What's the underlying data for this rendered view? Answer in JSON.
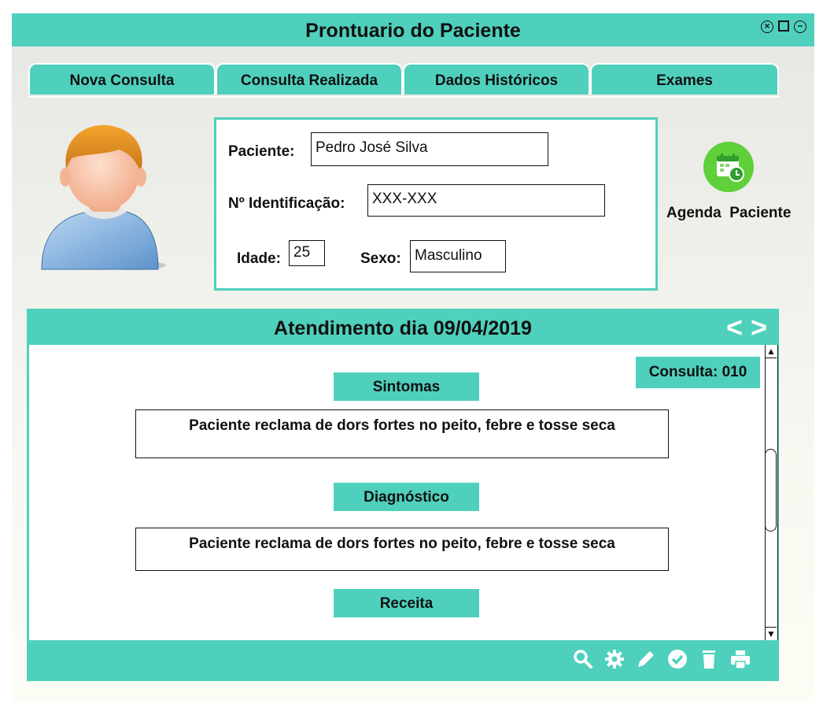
{
  "window": {
    "title": "Prontuario do Paciente"
  },
  "tabs": [
    {
      "label": "Nova Consulta"
    },
    {
      "label": "Consulta Realizada"
    },
    {
      "label": "Dados Históricos"
    },
    {
      "label": "Exames"
    }
  ],
  "patient": {
    "name_label": "Paciente:",
    "name_value": "Pedro José Silva",
    "id_label": "Nº Identificação:",
    "id_value": "XXX-XXX",
    "age_label": "Idade:",
    "age_value": "25",
    "sex_label": "Sexo:",
    "sex_value": "Masculino"
  },
  "agenda": {
    "label": "Agenda  Paciente",
    "icon": "calendar-clock-icon"
  },
  "atendimento": {
    "title": "Atendimento dia 09/04/2019",
    "consulta_badge": "Consulta: 010",
    "sintomas_label": "Sintomas",
    "sintomas_text": "Paciente reclama de dors fortes no peito, febre e tosse seca",
    "diagnostico_label": "Diagnóstico",
    "diagnostico_text": "Paciente reclama de dors fortes no peito, febre e tosse seca",
    "receita_label": "Receita"
  },
  "toolbar_icons": [
    "search-icon",
    "gear-icon",
    "pencil-icon",
    "check-icon",
    "trash-icon",
    "print-icon"
  ],
  "colors": {
    "accent": "#4fd0bd",
    "agenda_green": "#5fcf3a"
  }
}
